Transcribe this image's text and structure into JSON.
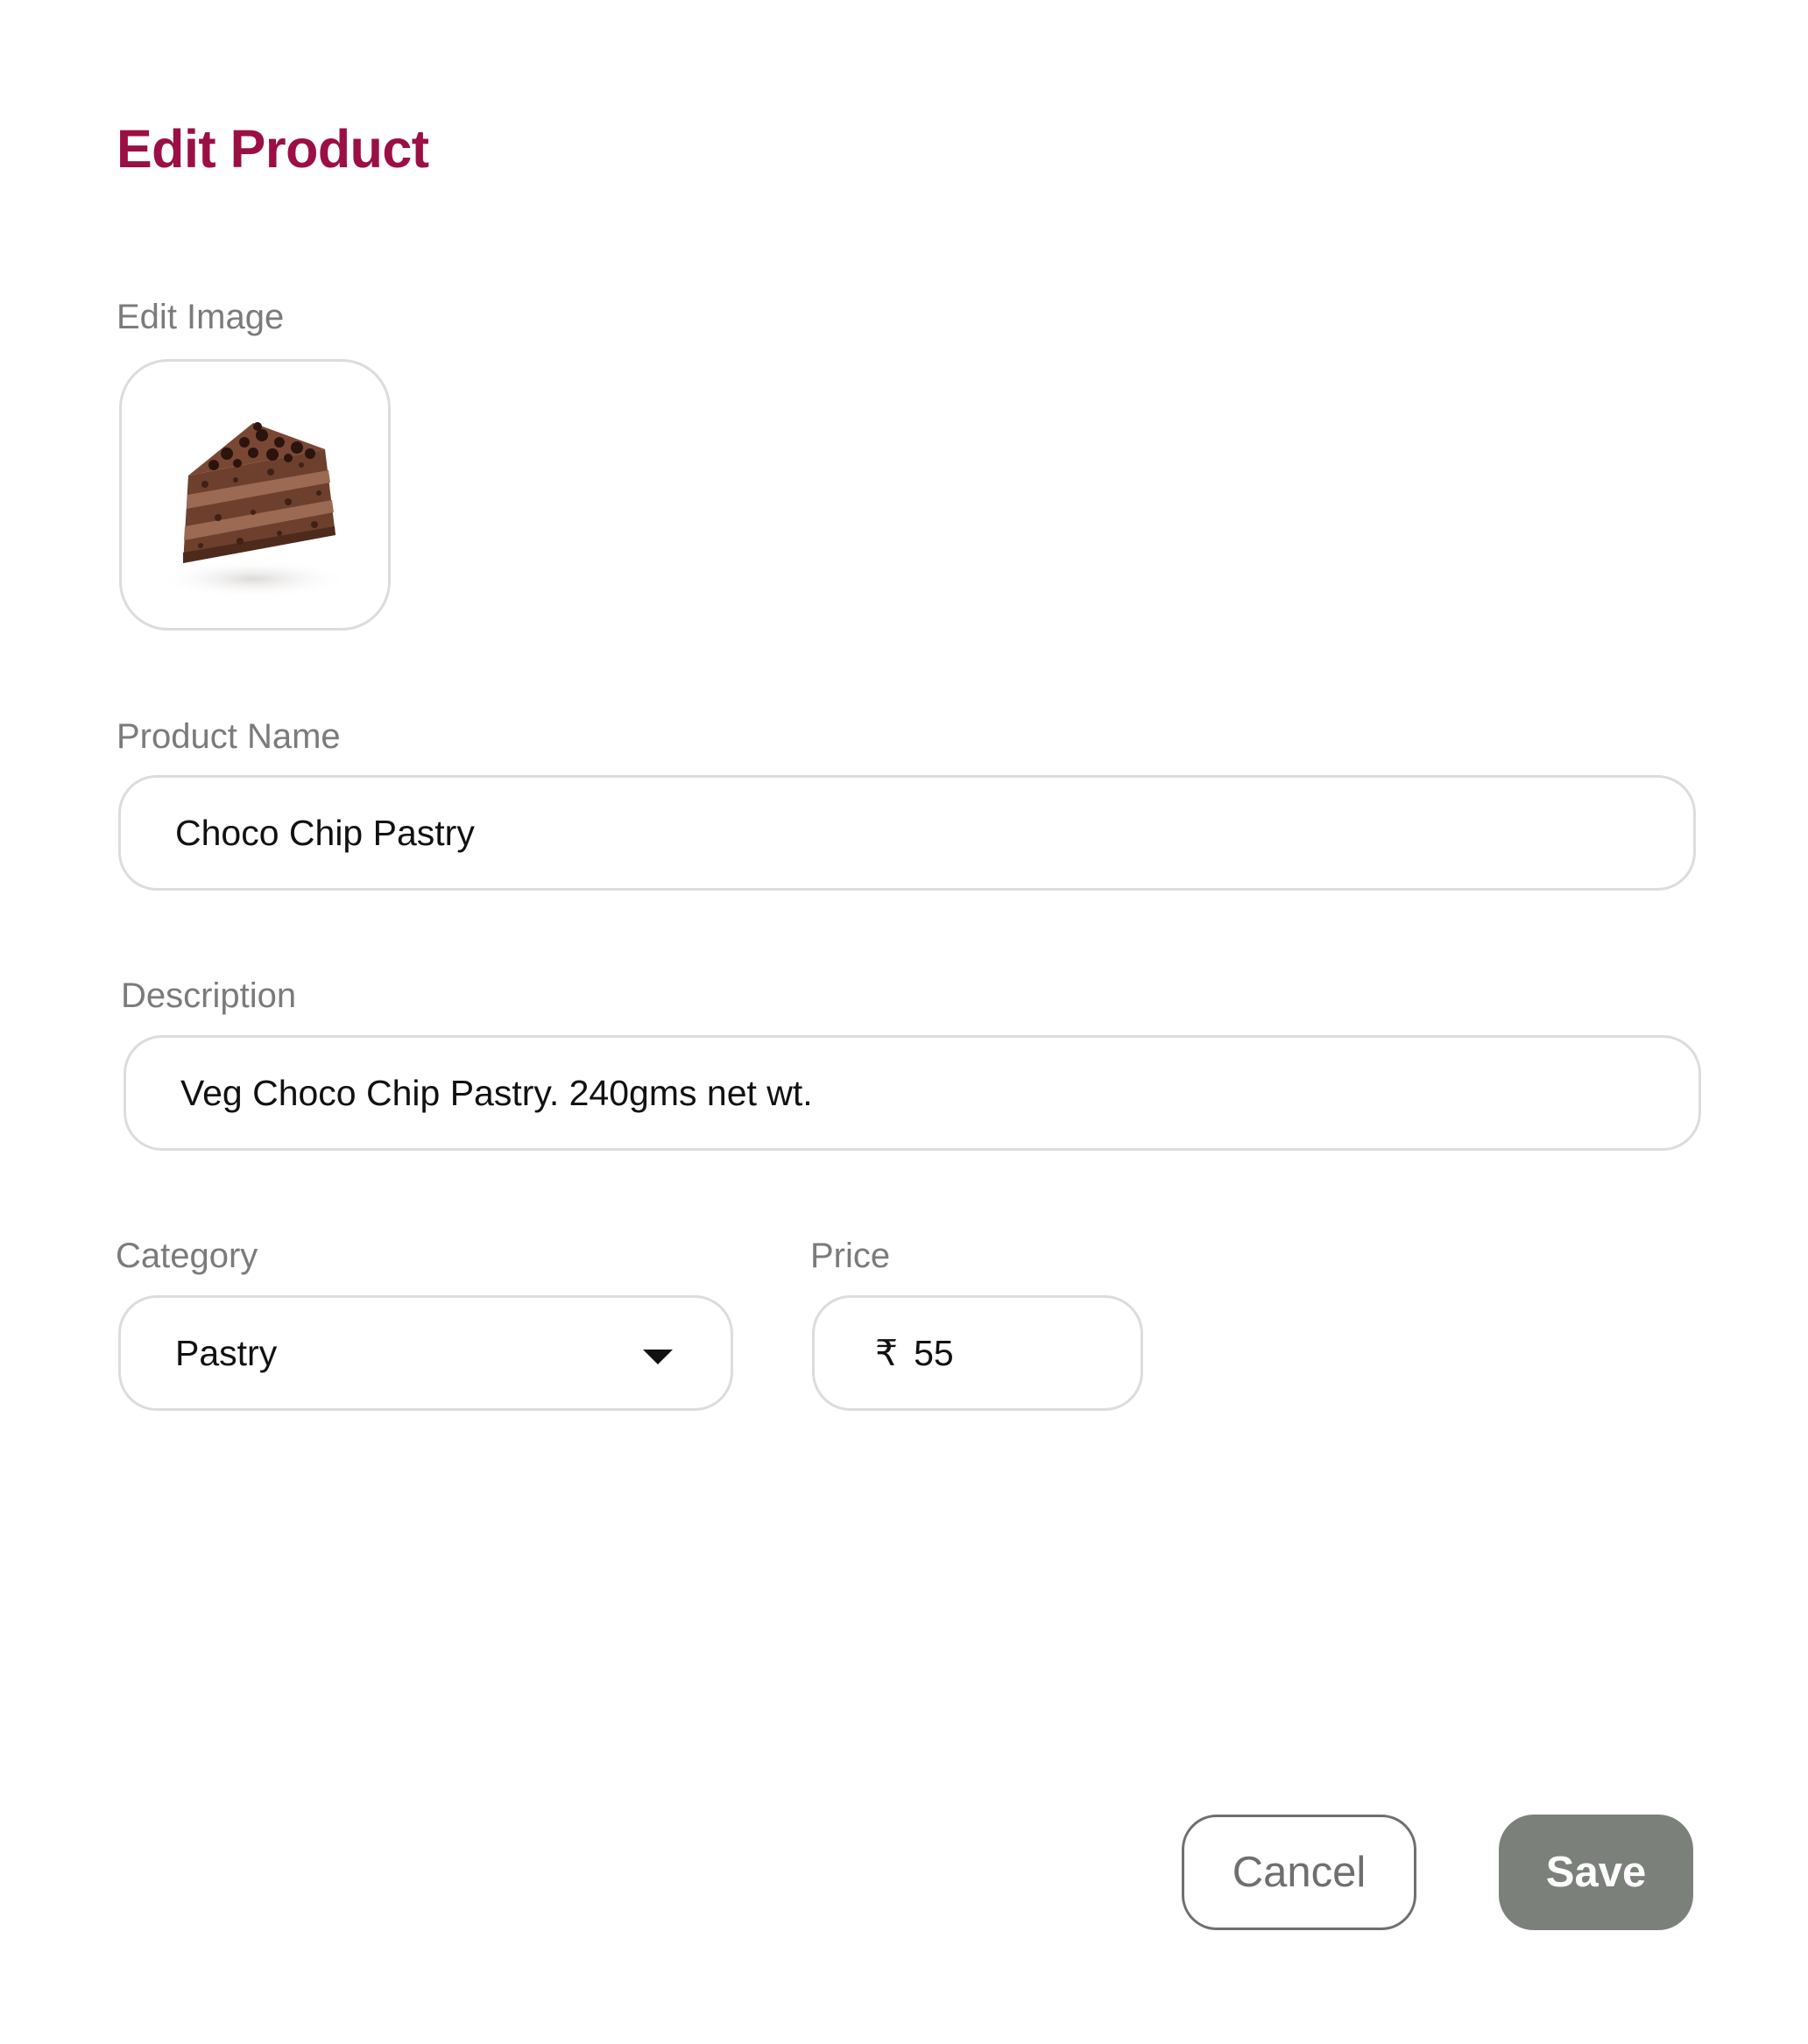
{
  "dialog": {
    "title": "Edit Product"
  },
  "image_section": {
    "label": "Edit Image",
    "image_icon": "chocolate-pastry-slice"
  },
  "product_name": {
    "label": "Product Name",
    "value": "Choco Chip Pastry"
  },
  "description": {
    "label": "Description",
    "value": "Veg Choco Chip Pastry. 240gms net wt."
  },
  "category": {
    "label": "Category",
    "value": "Pastry",
    "icon": "caret-down-icon"
  },
  "price": {
    "label": "Price",
    "currency_symbol": "₹",
    "value": "55"
  },
  "actions": {
    "cancel_label": "Cancel",
    "save_label": "Save"
  },
  "colors": {
    "title": "#9b0f45",
    "label": "#7b7b7b",
    "field_border": "#dcdcdc",
    "save_bg": "#7b807b"
  }
}
